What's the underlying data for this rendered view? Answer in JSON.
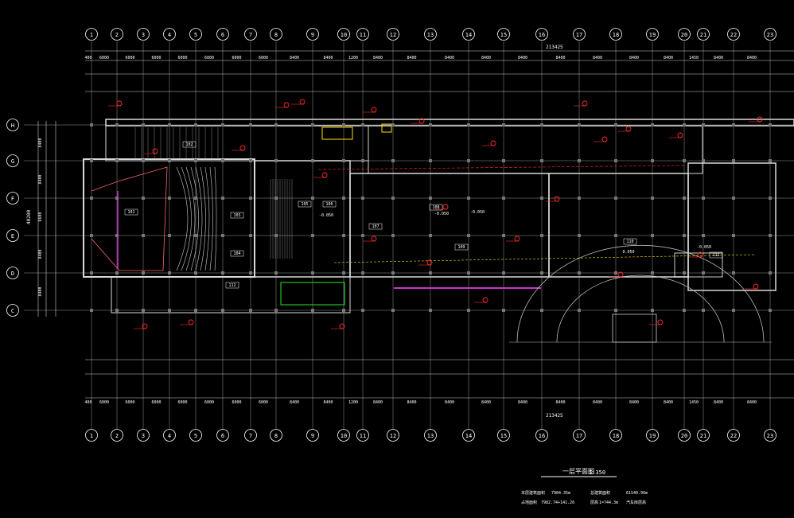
{
  "drawing": {
    "columns": [
      "1",
      "2",
      "3",
      "4",
      "5",
      "6",
      "7",
      "8",
      "9",
      "10",
      "11",
      "12",
      "13",
      "14",
      "15",
      "16",
      "17",
      "18",
      "19",
      "20",
      "21",
      "22",
      "23"
    ],
    "rows": [
      "H",
      "G",
      "F",
      "E",
      "D",
      "C"
    ],
    "top_dims": [
      "400",
      "6000",
      "6000",
      "6000",
      "6000",
      "6000",
      "6000",
      "6000",
      "8400",
      "8400",
      "1200",
      "8400",
      "8400",
      "8400",
      "8400",
      "8400",
      "8400",
      "8400",
      "8400",
      "8400",
      "1450",
      "8400",
      "8400"
    ],
    "bottom_dims": [
      "400",
      "6000",
      "6000",
      "6000",
      "6000",
      "6000",
      "6000",
      "6000",
      "8400",
      "8400",
      "1200",
      "8400",
      "8400",
      "8400",
      "8400",
      "8400",
      "8400",
      "8400",
      "8400",
      "8400",
      "1450",
      "8400",
      "8400"
    ],
    "side_dims": [
      "8400",
      "8400",
      "6600",
      "8400",
      "8400"
    ],
    "total_width": "213425",
    "total_width_bottom": "213425",
    "total_height": "40200",
    "title": "一层平面图",
    "scale": "1:350",
    "info": {
      "label1": "本层建筑面积",
      "value1": "7984.35m",
      "label2": "总建筑面积",
      "value2": "61540.96m",
      "label3": "占地面积",
      "value3": "7982.74+141.26",
      "label4": "层高",
      "value4": "1=744.3m",
      "note": "汽车库层高"
    },
    "rooms": [
      {
        "id": "r1",
        "label": "101"
      },
      {
        "id": "r2",
        "label": "102"
      },
      {
        "id": "r3",
        "label": "103"
      },
      {
        "id": "r4",
        "label": "104"
      },
      {
        "id": "r5",
        "label": "105"
      },
      {
        "id": "r6",
        "label": "106"
      },
      {
        "id": "r7",
        "label": "107"
      },
      {
        "id": "r8",
        "label": "108"
      },
      {
        "id": "r9",
        "label": "109"
      },
      {
        "id": "r10",
        "label": "110"
      },
      {
        "id": "r11",
        "label": "111"
      },
      {
        "id": "r12",
        "label": "112"
      }
    ],
    "levels": [
      "-0.050",
      "-0.050",
      "-0.050",
      "0.050",
      "-0.050"
    ],
    "colors": {
      "grid": "#ffffff",
      "wall": "#d9d9d9",
      "red": "#ff2a2a",
      "yellow": "#ffe100",
      "green": "#27e627",
      "magenta": "#d22fd2",
      "cyan": "#6cc6d8"
    }
  }
}
